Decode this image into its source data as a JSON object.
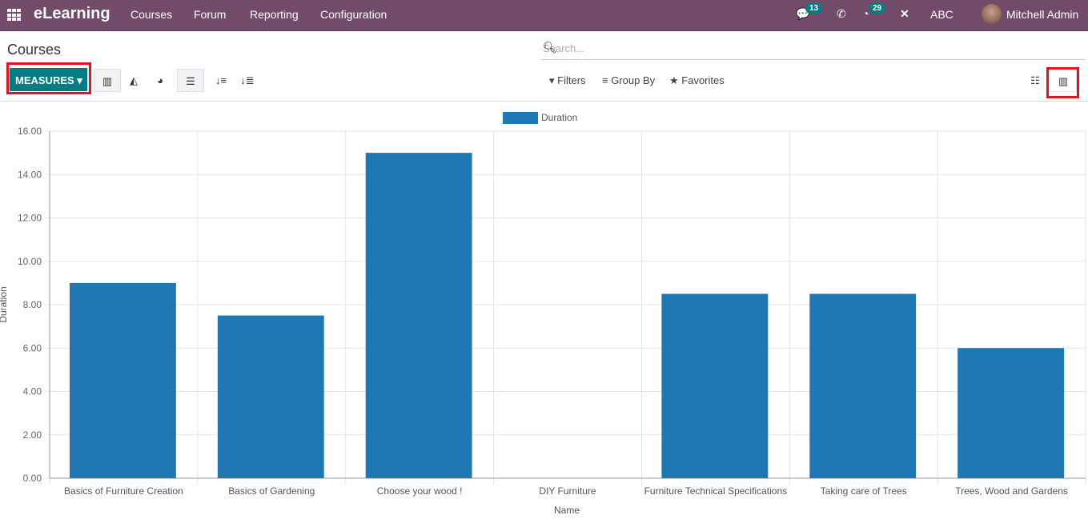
{
  "nav": {
    "brand": "eLearning",
    "menus": [
      "Courses",
      "Forum",
      "Reporting",
      "Configuration"
    ],
    "messages_count": "13",
    "activities_count": "29",
    "company": "ABC",
    "user": "Mitchell Admin"
  },
  "page": {
    "title": "Courses",
    "search_placeholder": "Search...",
    "measures_label": "MEASURES",
    "filters": "Filters",
    "group_by": "Group By",
    "favorites": "Favorites"
  },
  "colors": {
    "bar": "#1f77b4",
    "nav": "#714b67",
    "accent": "#017e84"
  },
  "chart_data": {
    "type": "bar",
    "categories": [
      "Basics of Furniture Creation",
      "Basics of Gardening",
      "Choose your wood !",
      "DIY Furniture",
      "Furniture Technical Specifications",
      "Taking care of Trees",
      "Trees, Wood and Gardens"
    ],
    "series": [
      {
        "name": "Duration",
        "values": [
          9,
          7.5,
          15,
          0,
          8.5,
          8.5,
          6
        ]
      }
    ],
    "xlabel": "Name",
    "ylabel": "Duration",
    "ylim": [
      0,
      16
    ],
    "yticks": [
      "0.00",
      "2.00",
      "4.00",
      "6.00",
      "8.00",
      "10.00",
      "12.00",
      "14.00",
      "16.00"
    ],
    "grid": true,
    "legend": "top-center"
  }
}
